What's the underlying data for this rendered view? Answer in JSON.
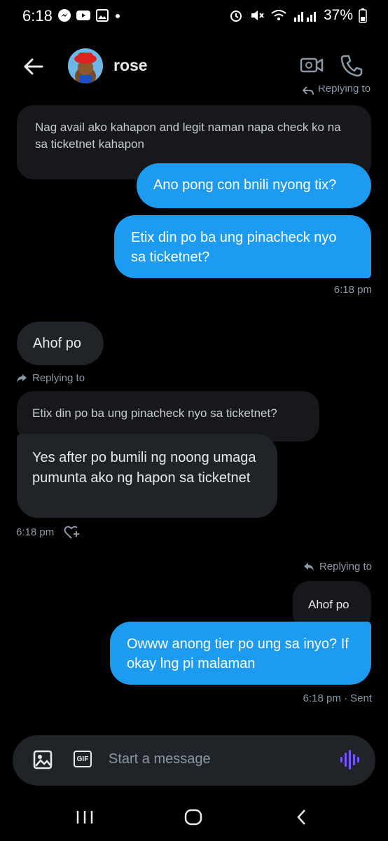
{
  "status_bar": {
    "time": "6:18",
    "battery": "37%"
  },
  "header": {
    "contact_name": "rose"
  },
  "messages": {
    "top_reply_tag": "Replying to",
    "m1_quoted": "Nag avail ako kahapon and legit naman napa check ko na sa ticketnet kahapon",
    "m2_out": "Ano pong con bnili nyong tix?",
    "m3_out": "Etix din po ba ung pinacheck nyo sa ticketnet?",
    "m3_time": "6:18 pm",
    "m4_in": "Ahof po",
    "m5_reply_tag": "Replying to",
    "m5_quoted": "Etix din po ba ung pinacheck nyo sa ticketnet?",
    "m5_in": "Yes after po bumili ng noong umaga pumunta ako ng hapon sa ticketnet",
    "m5_time": "6:18 pm",
    "m6_reply_tag": "Replying to",
    "m6_quoted": "Ahof po",
    "m6_out": "Owww anong tier po ung sa inyo? If okay lng pi malaman",
    "m6_time": "6:18 pm · Sent"
  },
  "composer": {
    "placeholder": "Start a message",
    "gif_label": "GIF"
  },
  "colors": {
    "accent": "#1d9bf0",
    "incoming": "#202327",
    "voice": "#7856ff"
  }
}
